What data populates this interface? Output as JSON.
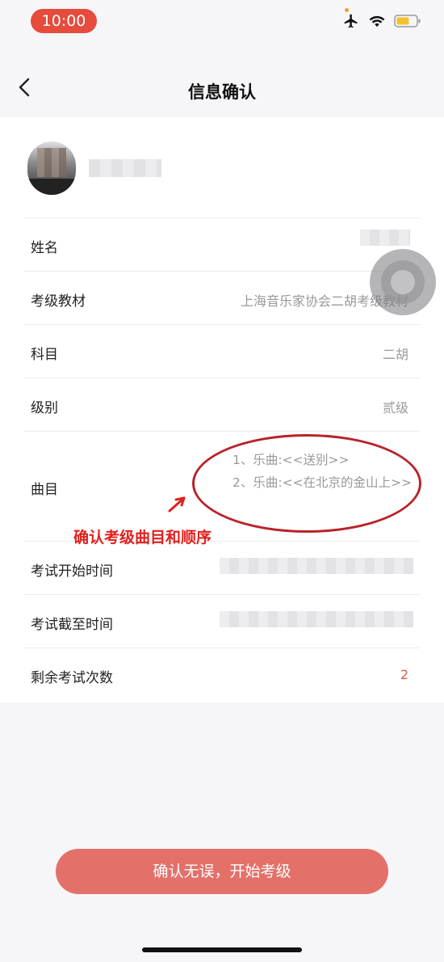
{
  "status_bar": {
    "time": "10:00"
  },
  "nav": {
    "title": "信息确认"
  },
  "rows": [
    {
      "label": "姓名",
      "value": ""
    },
    {
      "label": "考级教材",
      "value": "上海音乐家协会二胡考级教材"
    },
    {
      "label": "科目",
      "value": "二胡"
    },
    {
      "label": "级别",
      "value": "贰级"
    },
    {
      "label": "曲目",
      "songs": [
        "1、乐曲:<<送别>>",
        "2、乐曲:<<在北京的金山上>>"
      ]
    },
    {
      "label": "考试开始时间",
      "value": ""
    },
    {
      "label": "考试截至时间",
      "value": ""
    },
    {
      "label": "剩余考试次数",
      "value": "2"
    }
  ],
  "annotation": {
    "text": "确认考级曲目和顺序"
  },
  "confirm_button": {
    "label": "确认无误，开始考级"
  },
  "colors": {
    "accent": "#e3716a",
    "status_pill": "#e64b3c",
    "annotation_red": "#e0201e"
  }
}
